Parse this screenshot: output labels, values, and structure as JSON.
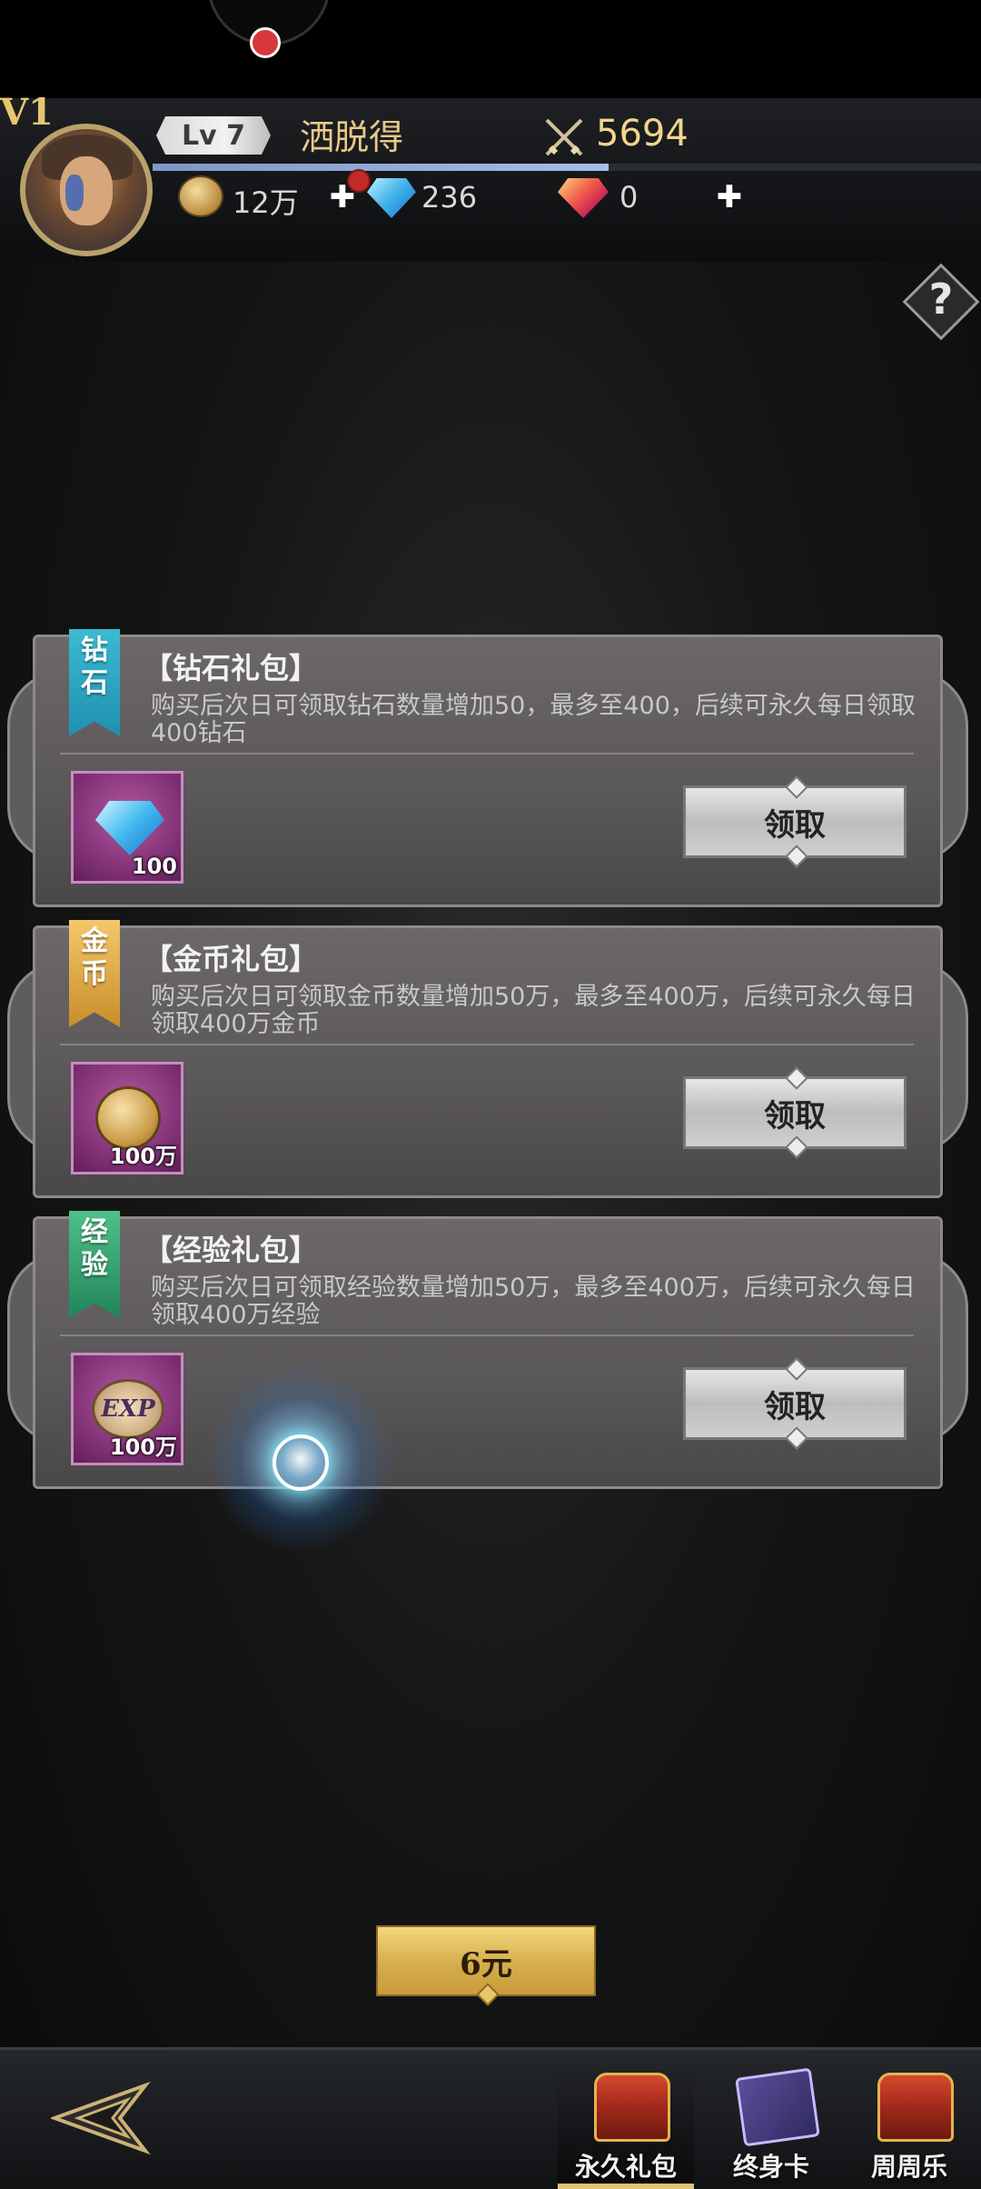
{
  "header": {
    "vip_label": "V1",
    "level": "Lv 7",
    "player_name": "洒脱得",
    "combat_power": "5694",
    "exp_progress": 0.55,
    "currencies": {
      "coins": "12万",
      "diamonds": "236",
      "rubies": "0"
    }
  },
  "help": {
    "label": "?"
  },
  "packs": [
    {
      "ribbon": "钻石",
      "ribbon_color": "#2fa8c8",
      "title": "【钻石礼包】",
      "description": "购买后次日可领取钻石数量增加50，最多至400，后续可永久每日领取400钻石",
      "item_icon": "diamond-icon",
      "item_qty": "100",
      "claim_label": "领取"
    },
    {
      "ribbon": "金币",
      "ribbon_color": "#e0a84a",
      "title": "【金币礼包】",
      "description": "购买后次日可领取金币数量增加50万，最多至400万，后续可永久每日领取400万金币",
      "item_icon": "coin-icon",
      "item_qty": "100万",
      "claim_label": "领取"
    },
    {
      "ribbon": "经验",
      "ribbon_color": "#35a370",
      "title": "【经验礼包】",
      "description": "购买后次日可领取经验数量增加50万，最多至400万，后续可永久每日领取400万经验",
      "item_icon": "exp-icon",
      "item_label": "EXP",
      "item_qty": "100万",
      "claim_label": "领取"
    }
  ],
  "purchase": {
    "price_label": "6元"
  },
  "nav": {
    "tabs": [
      {
        "label": "永久礼包",
        "icon": "treasure-chest-icon",
        "active": true
      },
      {
        "label": "终身卡",
        "icon": "card-icon",
        "active": false
      },
      {
        "label": "周周乐",
        "icon": "treasure-chest-icon",
        "active": false
      }
    ]
  },
  "colors": {
    "accent_gold": "#e2c27a",
    "name_color": "#e8c98a",
    "exp_bar": "#a7bde6"
  }
}
